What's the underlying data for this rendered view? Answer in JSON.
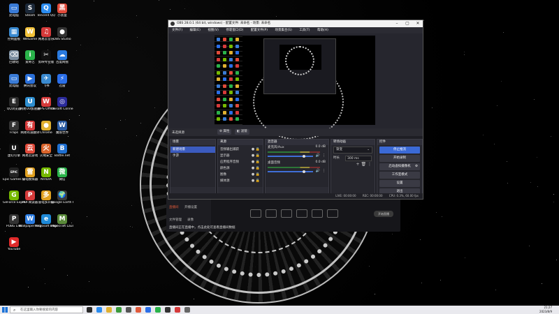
{
  "desktop": {
    "icons": [
      {
        "label": "此电脑",
        "color": "#3a7bd5",
        "glyph": "▭"
      },
      {
        "label": "Steam",
        "color": "#1b2838",
        "glyph": "S"
      },
      {
        "label": "Tencent QQ",
        "color": "#2a8cf0",
        "glyph": "Q"
      },
      {
        "label": "小黑盒",
        "color": "#e04a3a",
        "glyph": "黑"
      },
      {
        "label": "控制面板",
        "color": "#3a8ad0",
        "glyph": "▦"
      },
      {
        "label": "WeGame",
        "color": "#f2c23a",
        "glyph": "W"
      },
      {
        "label": "网易云音乐",
        "color": "#d53a3a",
        "glyph": "♫"
      },
      {
        "label": "OBS Studio",
        "color": "#333",
        "glyph": "●"
      },
      {
        "label": "回收站",
        "color": "#7c8ea0",
        "glyph": "⌫"
      },
      {
        "label": "爱奇艺",
        "color": "#2ab34a",
        "glyph": "i"
      },
      {
        "label": "剪映专业版",
        "color": "#111",
        "glyph": "✂"
      },
      {
        "label": "百度网盘",
        "color": "#2a7be0",
        "glyph": "☁"
      },
      {
        "label": "此电脑",
        "color": "#3a7bd5",
        "glyph": "▭"
      },
      {
        "label": "腾讯会议",
        "color": "#2a6fd8",
        "glyph": "▶"
      },
      {
        "label": "飞书",
        "color": "#3a8ad0",
        "glyph": "✈"
      },
      {
        "label": "迅雷",
        "color": "#2a6ee8",
        "glyph": "⚡"
      },
      {
        "label": "QQ浏览器",
        "color": "#2a2a2a",
        "glyph": "E"
      },
      {
        "label": "网易UU加速器",
        "color": "#2f8fd0",
        "glyph": "U"
      },
      {
        "label": "WPS Office",
        "color": "#d53a3a",
        "glyph": "W"
      },
      {
        "label": "Ubisoft Connect",
        "color": "#2a2a9a",
        "glyph": "◎"
      },
      {
        "label": "Fraps",
        "color": "#333",
        "glyph": "F"
      },
      {
        "label": "网易有道翻译",
        "color": "#d53a3a",
        "glyph": "有"
      },
      {
        "label": "Chrome",
        "color": "#e0b030",
        "glyph": "●"
      },
      {
        "label": "魔兽世界",
        "color": "#2a5aa0",
        "glyph": "W"
      },
      {
        "label": "虚幻引擎",
        "color": "#111",
        "glyph": "U"
      },
      {
        "label": "网易云游戏",
        "color": "#e04a3a",
        "glyph": "云"
      },
      {
        "label": "火绒安全",
        "color": "#d9632a",
        "glyph": "火"
      },
      {
        "label": "Battle.net",
        "color": "#1f6fd0",
        "glyph": "B"
      },
      {
        "label": "Epic Games Launcher",
        "color": "#222",
        "glyph": "EPIC"
      },
      {
        "label": "雷电模拟器",
        "color": "#e0a020",
        "glyph": "雷"
      },
      {
        "label": "NVIDIA",
        "color": "#76b900",
        "glyph": "N"
      },
      {
        "label": "微信",
        "color": "#2ab34a",
        "glyph": "微"
      },
      {
        "label": "GeForce Experience",
        "color": "#76b900",
        "glyph": "G"
      },
      {
        "label": "PDF阅读器",
        "color": "#d53a3a",
        "glyph": "P"
      },
      {
        "label": "雷电多开器",
        "color": "#e0a020",
        "glyph": "多"
      },
      {
        "label": "Google Earth Pro",
        "color": "#3a3a3a",
        "glyph": "🌍"
      },
      {
        "label": "PUBG Lite",
        "color": "#333",
        "glyph": "P"
      },
      {
        "label": "Wallpaper Engine",
        "color": "#2a7be0",
        "glyph": "W"
      },
      {
        "label": "Microsoft Edge",
        "color": "#1f8ad8",
        "glyph": "e"
      },
      {
        "label": "Minecraft Launcher",
        "color": "#5a8a3a",
        "glyph": "M"
      },
      {
        "label": "YouTube",
        "color": "#e02a2a",
        "glyph": "▶"
      }
    ]
  },
  "app2": {
    "tabs": [
      "直播间",
      "开播设置",
      "文件管理",
      "录像"
    ],
    "live_label": "开始直播",
    "message": "直播间正在直播中，点击此处可查看直播间数据"
  },
  "obs": {
    "title": "OBS 28.0.1 (64 bit, windows) - 配置文件: 未命名 - 场景: 未命名",
    "menu": [
      "文件(F)",
      "编辑(E)",
      "视图(V)",
      "停靠窗口(D)",
      "配置文件(P)",
      "场景集合(S)",
      "工具(T)",
      "帮助(H)"
    ],
    "midbar": {
      "scene_label": "未选择源",
      "properties": "属性",
      "filters": "滤镜"
    },
    "scenes": {
      "header": "场景",
      "items": [
        "新建场景",
        "手游"
      ]
    },
    "sources": {
      "header": "来源",
      "items": [
        "音频输出捕获",
        "显示器",
        "应用程序音频",
        "颜色源",
        "图像",
        "媒体源"
      ]
    },
    "mixer": {
      "header": "混音器",
      "tracks": [
        {
          "name": "麦克风/Aux",
          "db": "0.0 dB",
          "level": 0.62,
          "volume": 0.8
        },
        {
          "name": "桌面音频",
          "db": "0.0 dB",
          "level": 0.55,
          "volume": 0.8
        }
      ]
    },
    "transitions": {
      "header": "转场动画",
      "type": "渐变",
      "duration_label": "时长",
      "duration": "300 ms"
    },
    "controls": {
      "header": "控件",
      "buttons": [
        "停止推流",
        "开始录制",
        "启动虚拟摄像机",
        "工作室模式",
        "设置",
        "退出"
      ]
    },
    "status": {
      "live": "LIVE: 00:00:00",
      "rec": "REC: 00:00:00",
      "cpu": "CPU: 0.3%, 60.00 fps"
    }
  },
  "taskbar": {
    "search_placeholder": "在这里输入你要搜索的内容",
    "time": "21:27",
    "date": "2023/8/9"
  }
}
